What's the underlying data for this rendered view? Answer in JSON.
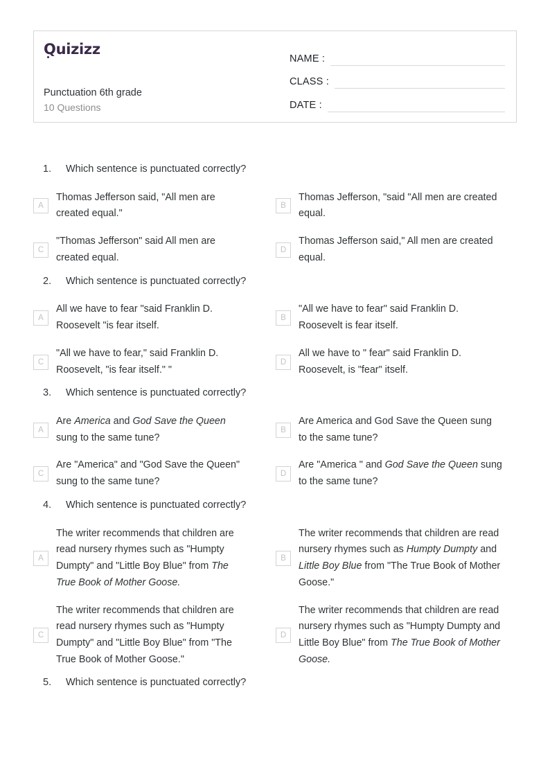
{
  "brand": {
    "logo_text": "Quizizz",
    "logo_color": "#3b2a4a"
  },
  "header": {
    "title": "Punctuation 6th grade",
    "question_count": "10 Questions",
    "fields": [
      {
        "label": "NAME :"
      },
      {
        "label": "CLASS :"
      },
      {
        "label": "DATE  :"
      }
    ]
  },
  "questions": [
    {
      "number": "1.",
      "prompt": "Which sentence is punctuated correctly?",
      "options": [
        {
          "letter": "A",
          "html": "Thomas Jefferson said, \"All men are created equal.\""
        },
        {
          "letter": "B",
          "html": "Thomas Jefferson, \"said \"All men are created equal."
        },
        {
          "letter": "C",
          "html": "\"Thomas Jefferson\" said All men are created equal."
        },
        {
          "letter": "D",
          "html": "Thomas Jefferson said,\" All men are created equal."
        }
      ]
    },
    {
      "number": "2.",
      "prompt": "Which sentence is punctuated correctly?",
      "options": [
        {
          "letter": "A",
          "html": "All we have to fear \"said Franklin D. Roosevelt \"is fear itself."
        },
        {
          "letter": "B",
          "html": "\"All we have to fear\" said Franklin D. Roosevelt is fear itself."
        },
        {
          "letter": "C",
          "html": "\"All we have to fear,\" said Franklin D. Roosevelt, \"is fear itself.\" \""
        },
        {
          "letter": "D",
          "html": "All we have to \" fear\" said Franklin D. Roosevelt, is \"fear\" itself."
        }
      ]
    },
    {
      "number": "3.",
      "prompt": "Which sentence is punctuated correctly?",
      "options": [
        {
          "letter": "A",
          "html": "Are <i>America</i> and <i>God Save the Queen</i> sung to the same tune?"
        },
        {
          "letter": "B",
          "html": "Are America and God Save the Queen sung to the same tune?"
        },
        {
          "letter": "C",
          "html": "Are \"America\" and \"God Save the Queen\" sung to the same tune?"
        },
        {
          "letter": "D",
          "html": "Are \"America \" and <i>God Save the Queen</i> sung to the same tune?"
        }
      ]
    },
    {
      "number": "4.",
      "prompt": "Which sentence is punctuated correctly?",
      "options": [
        {
          "letter": "A",
          "html": "The writer recommends that children are read nursery rhymes such as \"Humpty Dumpty\" and \"Little Boy Blue\" from <i>The True Book of Mother Goose.</i>"
        },
        {
          "letter": "B",
          "html": "The writer recommends that children are read nursery rhymes such as <i>Humpty Dumpty</i> and <i>Little Boy Blue</i> from \"The True Book of Mother Goose.\""
        },
        {
          "letter": "C",
          "html": "The writer recommends that children are read nursery rhymes such as \"Humpty Dumpty\" and \"Little Boy Blue\" from \"The True Book of Mother Goose.\""
        },
        {
          "letter": "D",
          "html": "The writer recommends that children are read nursery rhymes such as \"Humpty Dumpty and Little Boy Blue\" from <i>The True Book of Mother Goose.</i>"
        }
      ]
    },
    {
      "number": "5.",
      "prompt": "Which sentence is punctuated correctly?",
      "options": []
    }
  ]
}
